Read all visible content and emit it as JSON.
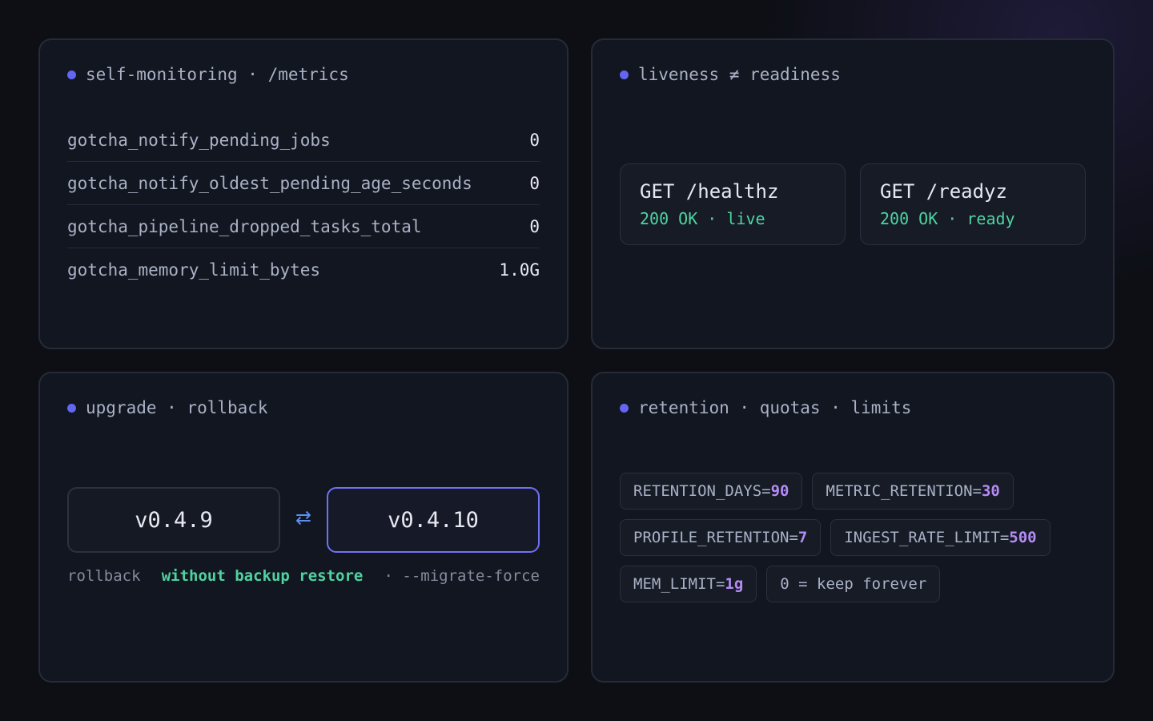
{
  "colors": {
    "accent_dot": "#6366f1",
    "ok_green": "#4fd3a0",
    "value_purple": "#b48cf4",
    "active_border": "#6f72f5",
    "swap_icon": "#5b8ff2"
  },
  "metrics_panel": {
    "title": "self-monitoring · /metrics",
    "rows": [
      {
        "name": "gotcha_notify_pending_jobs",
        "value": "0"
      },
      {
        "name": "gotcha_notify_oldest_pending_age_seconds",
        "value": "0"
      },
      {
        "name": "gotcha_pipeline_dropped_tasks_total",
        "value": "0"
      },
      {
        "name": "gotcha_memory_limit_bytes",
        "value": "1.0G"
      }
    ]
  },
  "health_panel": {
    "title": "liveness ≠ readiness",
    "endpoints": [
      {
        "route": "GET /healthz",
        "status": "200 OK · live"
      },
      {
        "route": "GET /readyz",
        "status": "200 OK · ready"
      }
    ]
  },
  "upgrade_panel": {
    "title": "upgrade · rollback",
    "from_version": "v0.4.9",
    "to_version": "v0.4.10",
    "swap_icon": "bidirectional-arrows-icon",
    "swap_glyph": "⇄",
    "note_prefix": "rollback",
    "note_emphasis": "without backup restore",
    "note_suffix": "· --migrate-force"
  },
  "retention_panel": {
    "title": "retention · quotas · limits",
    "chip_rows": [
      [
        {
          "key": "RETENTION_DAYS=",
          "value": "90"
        },
        {
          "key": "METRIC_RETENTION=",
          "value": "30"
        }
      ],
      [
        {
          "key": "PROFILE_RETENTION=",
          "value": "7"
        },
        {
          "key": "INGEST_RATE_LIMIT=",
          "value": "500"
        }
      ],
      [
        {
          "key": "MEM_LIMIT=",
          "value": "1g"
        },
        {
          "key": "0 = keep forever",
          "value": ""
        }
      ]
    ]
  }
}
